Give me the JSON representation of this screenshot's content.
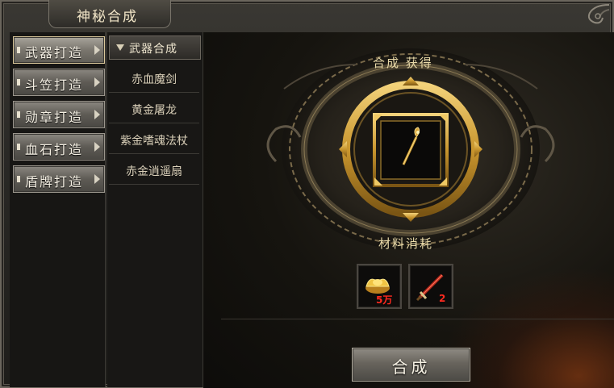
{
  "window": {
    "title": "神秘合成"
  },
  "categories": [
    {
      "label": "武器打造",
      "active": true
    },
    {
      "label": "斗笠打造",
      "active": false
    },
    {
      "label": "勋章打造",
      "active": false
    },
    {
      "label": "血石打造",
      "active": false
    },
    {
      "label": "盾牌打造",
      "active": false
    }
  ],
  "recipe_list": {
    "header": "武器合成",
    "items": [
      "赤血魔剑",
      "黄金屠龙",
      "紫金嗜魂法杖",
      "赤金逍遥扇"
    ]
  },
  "synthesis": {
    "result_label": "合成 获得",
    "result_item_icon": "golden-staff-icon",
    "materials_label": "材料消耗",
    "materials": [
      {
        "icon": "gold-ingot-icon",
        "qty": "5万"
      },
      {
        "icon": "red-sword-icon",
        "qty": "2"
      }
    ],
    "button_label": "合成"
  },
  "colors": {
    "gold": "#c9a24a",
    "quantity_red": "#ff2a1f",
    "label_gold": "#e8d9a8"
  }
}
